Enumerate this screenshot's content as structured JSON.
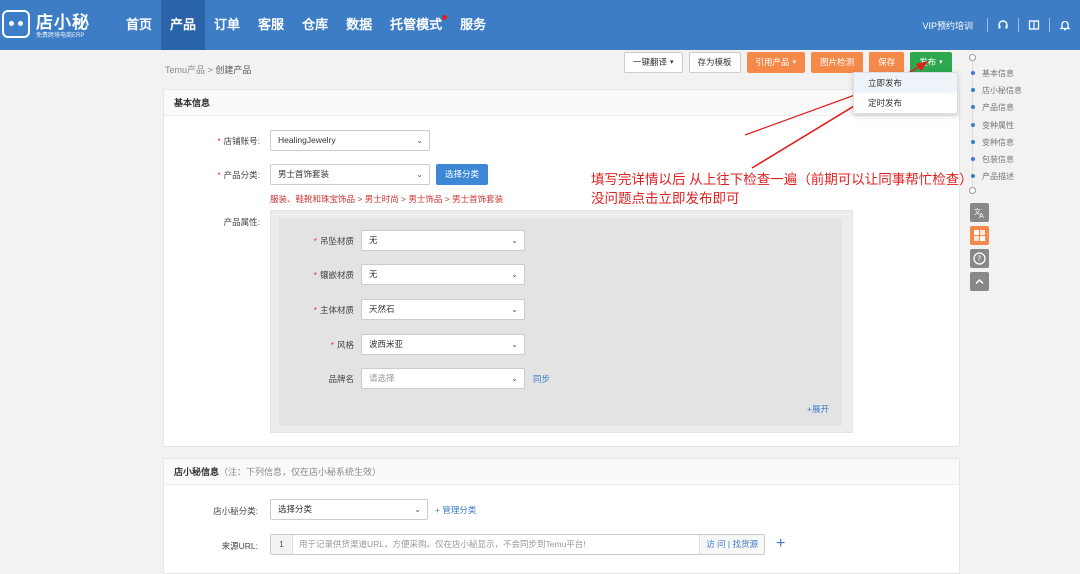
{
  "app": {
    "logo_name": "店小秘",
    "logo_sub": "免费跨境电商ERP"
  },
  "nav": [
    {
      "label": "首页"
    },
    {
      "label": "产品",
      "active": true
    },
    {
      "label": "订单"
    },
    {
      "label": "客服"
    },
    {
      "label": "仓库"
    },
    {
      "label": "数据"
    },
    {
      "label": "托管模式",
      "dot": true
    },
    {
      "label": "服务"
    }
  ],
  "topright": {
    "vip": "VIP预约培训"
  },
  "breadcrumb": {
    "root": "Temu产品",
    "sep": ">",
    "current": "创建产品"
  },
  "actions": {
    "translate": "一键翻译",
    "save_template": "存为模板",
    "quote": "引用产品",
    "image_check": "图片检测",
    "save": "保存",
    "publish": "发布"
  },
  "publish_menu": {
    "now": "立即发布",
    "scheduled": "定时发布"
  },
  "basic": {
    "title": "基本信息",
    "store_label": "店铺账号:",
    "store_value": "HealingJewelry",
    "category_label": "产品分类:",
    "category_value": "男士首饰套装",
    "choose_btn": "选择分类",
    "category_path": "服装、鞋靴和珠宝饰品 > 男士时尚 > 男士饰品 > 男士首饰套装",
    "attr_label": "产品属性:",
    "attrs": [
      {
        "label": "吊坠材质",
        "value": "无",
        "required": true
      },
      {
        "label": "镶嵌材质",
        "value": "无",
        "required": true
      },
      {
        "label": "主体材质",
        "value": "天然石",
        "required": true
      },
      {
        "label": "风格",
        "value": "波西米亚",
        "required": true
      },
      {
        "label": "品牌名",
        "value": "请选择",
        "required": false
      }
    ],
    "sync": "同步",
    "expand": "+展开"
  },
  "dxm": {
    "title": "店小秘信息",
    "note": "（注：下列信息，仅在店小秘系统生效）",
    "cat_label": "店小秘分类:",
    "cat_value": "选择分类",
    "manage": "+ 管理分类",
    "url_label": "来源URL:",
    "url_prefix": "1",
    "url_placeholder": "用于记录供货渠道URL，方便采购。仅在店小秘显示，不会同步到Temu平台!",
    "url_visit": "访 问",
    "url_find": "找货源"
  },
  "annotation": {
    "line1": "填写完详情以后 从上往下检查一遍（前期可以让同事帮忙检查）",
    "line2": "没问题点击立即发布即可"
  },
  "anchor_nav": [
    "基本信息",
    "店小秘信息",
    "产品信息",
    "变种属性",
    "变种信息",
    "包装信息",
    "产品描述"
  ],
  "colors": {
    "topbar": "#3c7dc6",
    "accent_orange": "#f5894a",
    "accent_green": "#2ea84f",
    "annotation": "#e02020"
  }
}
